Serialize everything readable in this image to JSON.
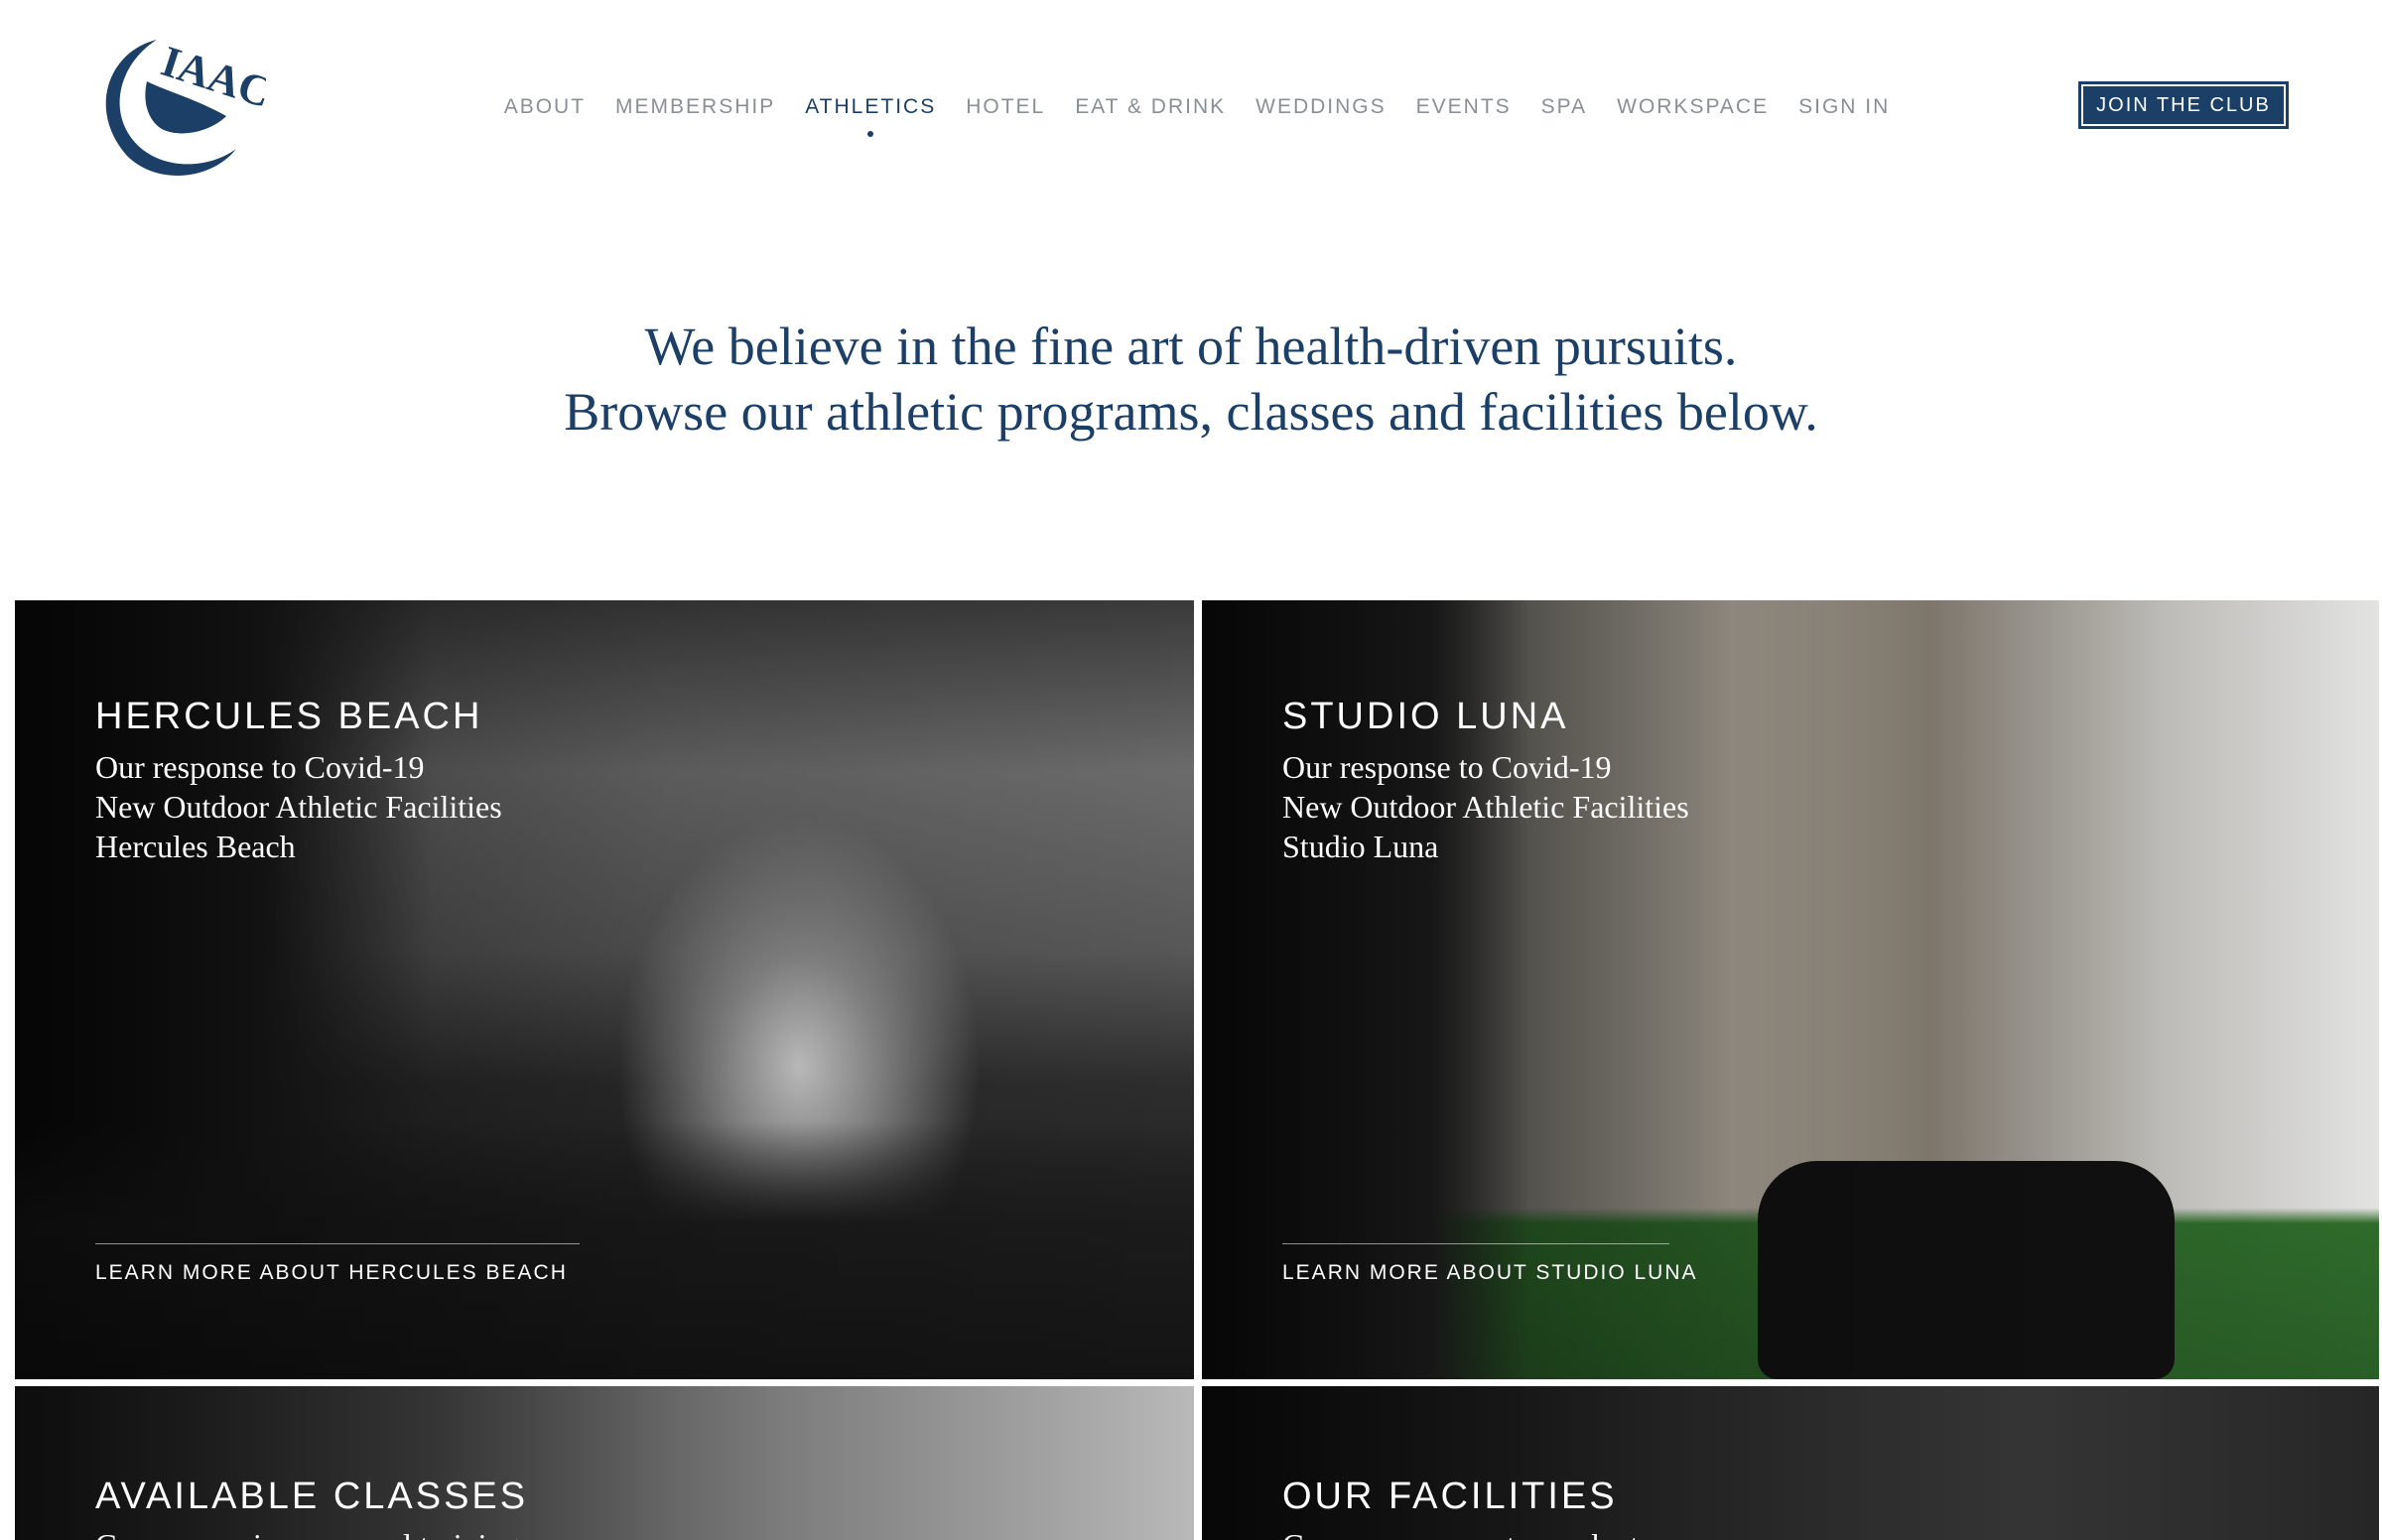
{
  "header": {
    "logo_text": "IAAC",
    "nav": [
      {
        "label": "ABOUT",
        "active": false
      },
      {
        "label": "MEMBERSHIP",
        "active": false
      },
      {
        "label": "ATHLETICS",
        "active": true
      },
      {
        "label": "HOTEL",
        "active": false
      },
      {
        "label": "EAT & DRINK",
        "active": false
      },
      {
        "label": "WEDDINGS",
        "active": false
      },
      {
        "label": "EVENTS",
        "active": false
      },
      {
        "label": "SPA",
        "active": false
      },
      {
        "label": "WORKSPACE",
        "active": false
      },
      {
        "label": "SIGN IN",
        "active": false
      }
    ],
    "join_label": "JOIN THE CLUB"
  },
  "intro": {
    "line1": "We believe in the fine art of health-driven pursuits.",
    "line2": "Browse our athletic programs, classes and facilities below."
  },
  "cards": [
    {
      "title": "HERCULES BEACH",
      "lines": [
        "Our response to Covid-19",
        "New Outdoor Athletic Facilities",
        "Hercules Beach"
      ],
      "cta": "LEARN MORE ABOUT HERCULES BEACH"
    },
    {
      "title": "STUDIO LUNA",
      "lines": [
        "Our response to Covid-19",
        "New Outdoor Athletic Facilities",
        "Studio Luna"
      ],
      "cta": "LEARN MORE ABOUT STUDIO LUNA"
    },
    {
      "title": "AVAILABLE CLASSES",
      "lines": [
        "Group exercise, personal training"
      ]
    },
    {
      "title": "OUR FACILITIES",
      "lines": [
        "Gym, sauna, courts, pool, etc."
      ]
    }
  ],
  "colors": {
    "brand": "#1b3f66",
    "nav_inactive": "#8a8f96",
    "background": "#ffffff"
  }
}
